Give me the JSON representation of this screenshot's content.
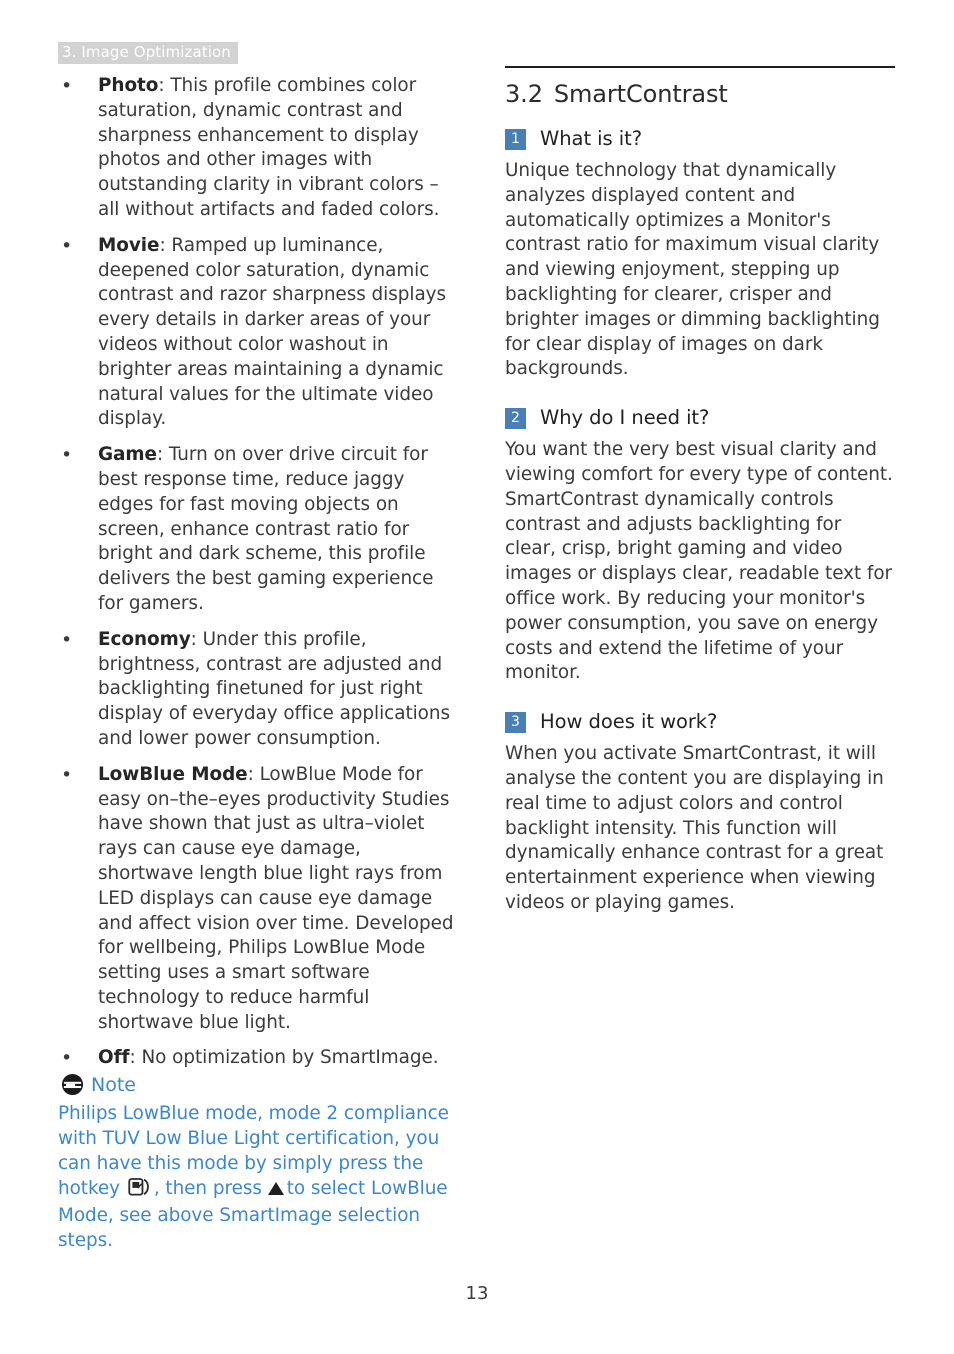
{
  "header": {
    "chapter_label": "3. Image Optimization",
    "highlight_color": "#d2d2d2",
    "text_color": "#ffffff"
  },
  "colors": {
    "body_text": "#3b3b3b",
    "note_blue": "#3d87c9",
    "badge_blue": "#4a7fb5",
    "rule_black": "#1d1d1d"
  },
  "left_column": {
    "bullets": [
      {
        "bullet": "•",
        "term": "Photo",
        "separator": ": ",
        "text": "This profile combines color saturation, dynamic contrast and sharpness enhancement to display photos and other images with outstanding clarity in vibrant colors – all without artifacts and faded colors."
      },
      {
        "bullet": "•",
        "term": "Movie",
        "separator": ": ",
        "text": "Ramped up luminance, deepened color saturation, dynamic contrast and razor sharpness displays every details in darker areas of your videos without color washout in brighter areas maintaining a dynamic natural values for the ultimate video display."
      },
      {
        "bullet": "•",
        "term": "Game",
        "separator": ": ",
        "text": "Turn on over drive circuit for best response time, reduce jaggy edges for fast moving objects on screen, enhance contrast ratio for bright and dark scheme, this profile delivers the best gaming experience for gamers."
      },
      {
        "bullet": "•",
        "term": "Economy",
        "separator": ": ",
        "text": "Under this profile, brightness, contrast are adjusted and backlighting finetuned for just right display of everyday office applications and lower power consumption."
      },
      {
        "bullet": "•",
        "term": "LowBlue Mode",
        "separator": ": ",
        "text": "LowBlue Mode for easy on–the–eyes productivity Studies have shown that just as ultra–violet rays can cause eye damage, shortwave length blue light rays from LED displays can cause eye damage and affect vision over time.  Developed for wellbeing, Philips LowBlue Mode setting uses a smart software technology to reduce harmful shortwave blue light."
      },
      {
        "bullet": "•",
        "term": "Off",
        "separator": ": ",
        "text": "No optimization by SmartImage."
      }
    ],
    "note": {
      "icon_name": "note-icon",
      "label": "Note",
      "text_part1": "Philips LowBlue mode, mode 2 compliance with TUV Low Blue Light certification, you can have this mode by simply press the hotkey",
      "hotkey_icon_name": "smartimage-hotkey-icon",
      "text_part2": ", then press",
      "arrow_icon_name": "triangle-up-icon",
      "text_part3": "to select LowBlue Mode, see above SmartImage selection steps."
    }
  },
  "right_column": {
    "section_number": "3.2",
    "section_title": "SmartContrast",
    "qa": [
      {
        "badge": "1",
        "question": "What is it?",
        "answer": "Unique technology that dynamically analyzes displayed content and automatically optimizes a Monitor's contrast ratio for maximum visual clarity and viewing enjoyment, stepping up backlighting for clearer, crisper and brighter images or dimming backlighting for clear display of images on dark backgrounds."
      },
      {
        "badge": "2",
        "question": "Why do I need it?",
        "answer": "You want the very best visual clarity and viewing comfort for every type of content. SmartContrast dynamically controls contrast and adjusts backlighting for clear, crisp, bright gaming and video images or displays clear, readable text for office work. By reducing your monitor's power consumption, you save on energy costs and extend the lifetime of your monitor."
      },
      {
        "badge": "3",
        "question": "How does it work?",
        "answer": "When you activate SmartContrast, it will analyse the content you are displaying in real time to adjust colors and control backlight intensity. This function will dynamically enhance contrast for a great entertainment experience when viewing videos or playing games."
      }
    ]
  },
  "footer": {
    "page_number": "13"
  }
}
